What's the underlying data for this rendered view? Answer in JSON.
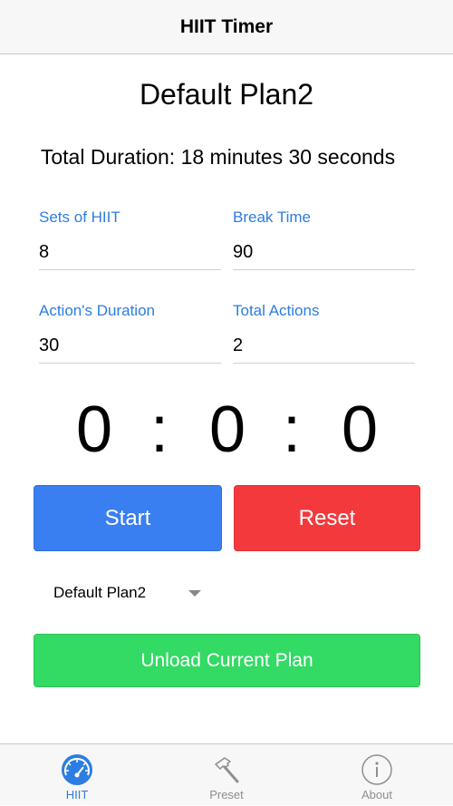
{
  "navbar": {
    "title": "HIIT Timer"
  },
  "plan": {
    "title": "Default Plan2",
    "total_duration": "Total Duration: 18 minutes 30 seconds"
  },
  "fields": {
    "sets": {
      "label": "Sets of HIIT",
      "value": "8"
    },
    "break_time": {
      "label": "Break Time",
      "value": "90"
    },
    "action_duration": {
      "label": "Action's Duration",
      "value": "30"
    },
    "total_actions": {
      "label": "Total Actions",
      "value": "2"
    }
  },
  "timer": {
    "hours": "0",
    "minutes": "0",
    "seconds": "0",
    "separator": ":"
  },
  "buttons": {
    "start": "Start",
    "reset": "Reset",
    "unload": "Unload Current Plan"
  },
  "plan_select": {
    "selected": "Default Plan2"
  },
  "tabbar": {
    "tabs": [
      {
        "label": "HIIT",
        "icon": "speedometer-icon",
        "active": true
      },
      {
        "label": "Preset",
        "icon": "hammer-icon",
        "active": false
      },
      {
        "label": "About",
        "icon": "info-icon",
        "active": false
      }
    ]
  },
  "colors": {
    "accent": "#2b7de1",
    "start": "#3a7ff1",
    "reset": "#f4393c",
    "unload": "#33da64"
  }
}
